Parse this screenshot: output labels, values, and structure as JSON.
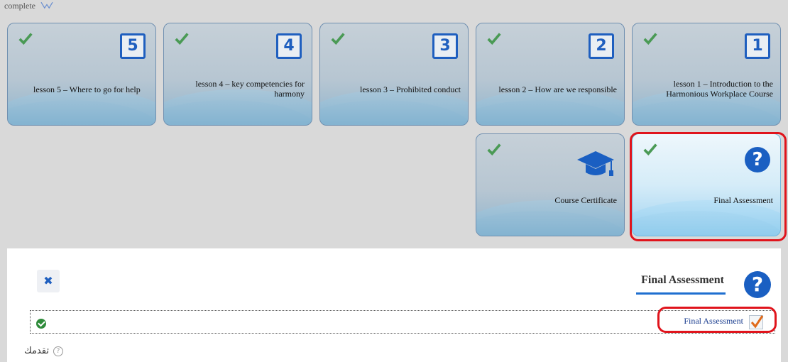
{
  "status_text": "complete",
  "tiles": [
    {
      "number": "5",
      "label": "lesson 5 – Where to go for help"
    },
    {
      "number": "4",
      "label": "lesson 4 – key competencies for harmony"
    },
    {
      "number": "3",
      "label": "lesson 3 – Prohibited conduct"
    },
    {
      "number": "2",
      "label": "lesson 2 – How are we responsible"
    },
    {
      "number": "1",
      "label": "lesson 1 – Introduction to the Harmonious Workplace Course"
    }
  ],
  "certificate_tile": {
    "label": "Course Certificate"
  },
  "assessment_tile": {
    "label": "Final Assessment",
    "icon": "?"
  },
  "panel": {
    "close_label": "✖",
    "title": "Final Assessment",
    "icon": "?",
    "item_label": "Final Assessment",
    "progress_label": "تقدمك",
    "help_icon": "?"
  },
  "colors": {
    "accent": "#1f5fbf",
    "highlight": "#e0141c",
    "success": "#2e8b3a"
  }
}
